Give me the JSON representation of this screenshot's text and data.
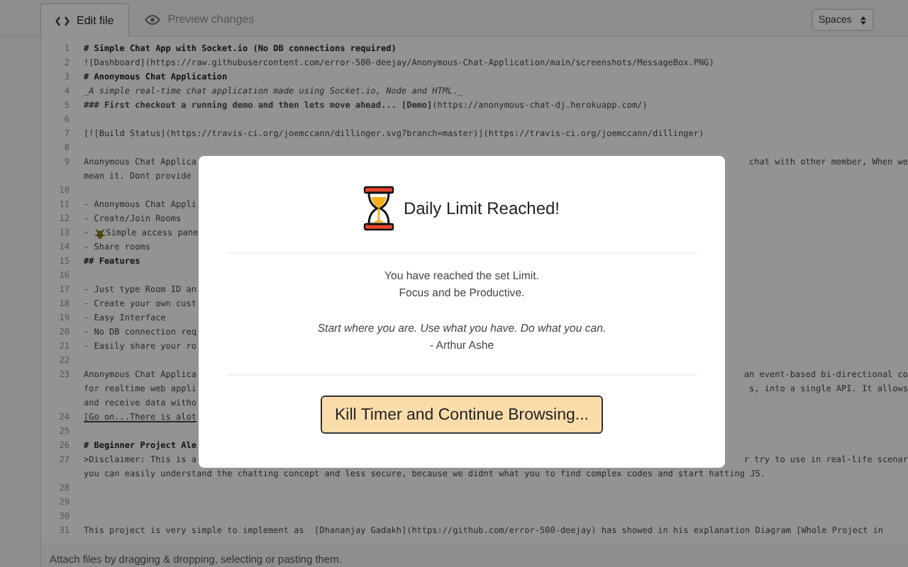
{
  "tabs": [
    {
      "label": "Edit file",
      "selected": true
    },
    {
      "label": "Preview changes",
      "selected": false
    }
  ],
  "indent_select": {
    "value": "Spaces"
  },
  "editor": {
    "lines": [
      {
        "number": "1",
        "kind": "heading",
        "rows": [
          {
            "left": "# Simple Chat App with Socket.io (No DB connections required)"
          }
        ]
      },
      {
        "number": "2",
        "kind": "plain",
        "rows": [
          {
            "left": "![Dashboard](https://raw.githubusercontent.com/error-500-deejay/Anonymous-Chat-Application/main/screenshots/MessageBox.PNG)"
          }
        ]
      },
      {
        "number": "3",
        "kind": "heading",
        "rows": [
          {
            "left": "# Anonymous Chat Application"
          }
        ]
      },
      {
        "number": "4",
        "kind": "emphasis",
        "rows": [
          {
            "left": "_A simple real-time chat application made using Socket.io, Node and HTML._"
          }
        ]
      },
      {
        "number": "5",
        "kind": "plain",
        "rows": [
          {
            "left": "**### First checkout a running demo and then lets move ahead... [Demo]**(https://anonymous-chat-dj.herokuapp.com/)"
          }
        ]
      },
      {
        "number": "6"
      },
      {
        "number": "7",
        "kind": "plain",
        "rows": [
          {
            "left": "[![Build Status](https://travis-ci.org/joemccann/dillinger.svg?branch=master)](https://travis-ci.org/joemccann/dillinger)"
          }
        ]
      },
      {
        "number": "8"
      },
      {
        "number": "9",
        "kind": "plain",
        "rows": [
          {
            "left": "Anonymous Chat Applica",
            "right": "chat with other member, When we"
          },
          {
            "left": "mean it. Dont provide"
          }
        ]
      },
      {
        "number": "10"
      },
      {
        "number": "11",
        "kind": "plain",
        "rows": [
          {
            "left": "- Anonymous Chat Appli"
          }
        ]
      },
      {
        "number": "12",
        "kind": "plain",
        "rows": [
          {
            "left": "- Create/Join Rooms"
          }
        ]
      },
      {
        "number": "13",
        "kind": "emoji-item",
        "rows": [
          {
            "left": "-",
            "rest": "Simple access pane"
          }
        ]
      },
      {
        "number": "14",
        "kind": "plain",
        "rows": [
          {
            "left": "- Share rooms"
          }
        ]
      },
      {
        "number": "15",
        "kind": "heading",
        "rows": [
          {
            "left": "## Features"
          }
        ]
      },
      {
        "number": "16"
      },
      {
        "number": "17",
        "kind": "plain",
        "rows": [
          {
            "left": "- Just type Room ID an"
          }
        ]
      },
      {
        "number": "18",
        "kind": "plain",
        "rows": [
          {
            "left": "- Create your own cust"
          }
        ]
      },
      {
        "number": "19",
        "kind": "plain",
        "rows": [
          {
            "left": "- Easy Interface"
          }
        ]
      },
      {
        "number": "20",
        "kind": "plain",
        "rows": [
          {
            "left": "- No DB connection req"
          }
        ]
      },
      {
        "number": "21",
        "kind": "plain",
        "rows": [
          {
            "left": "- Easily share your ro"
          }
        ]
      },
      {
        "number": "22"
      },
      {
        "number": "23",
        "kind": "plain",
        "rows": [
          {
            "left": "Anonymous Chat Applica",
            "right": "an event-based bi-directional co"
          },
          {
            "left": "for realtime web appli",
            "right": "s, into a single API. It allows"
          },
          {
            "left": "and receive data witho"
          }
        ]
      },
      {
        "number": "24",
        "kind": "link",
        "rows": [
          {
            "left": "[Go on...There is alot"
          }
        ]
      },
      {
        "number": "25"
      },
      {
        "number": "26",
        "kind": "heading",
        "rows": [
          {
            "left": "# Beginner Project Ale"
          }
        ]
      },
      {
        "number": "27",
        "kind": "plain",
        "rows": [
          {
            "left": ">Disclaimer: This is a",
            "right": "r try to use in real-life scenar"
          },
          {
            "left": "you can easily understand the chatting concept and less secure, because we didnt what you to find complex codes and start hatting JS."
          }
        ]
      },
      {
        "number": "28"
      },
      {
        "number": "29"
      },
      {
        "number": "30"
      },
      {
        "number": "31",
        "kind": "plain",
        "rows": [
          {
            "left": "This project is very simple to implement as  [Dhananjay Gadakh](https://github.com/error-500-deejay) has showed in his explanation Diagram [Whole Project in"
          }
        ]
      }
    ]
  },
  "attach_hint": "Attach files by dragging & dropping, selecting or pasting them.",
  "modal": {
    "title": "Daily Limit Reached!",
    "message_lines": [
      "You have reached the set Limit.",
      "Focus and be Productive."
    ],
    "quote": "Start where you are. Use what you have. Do what you can.",
    "quote_author": "- Arthur Ashe",
    "button": "Kill Timer and Continue Browsing..."
  }
}
